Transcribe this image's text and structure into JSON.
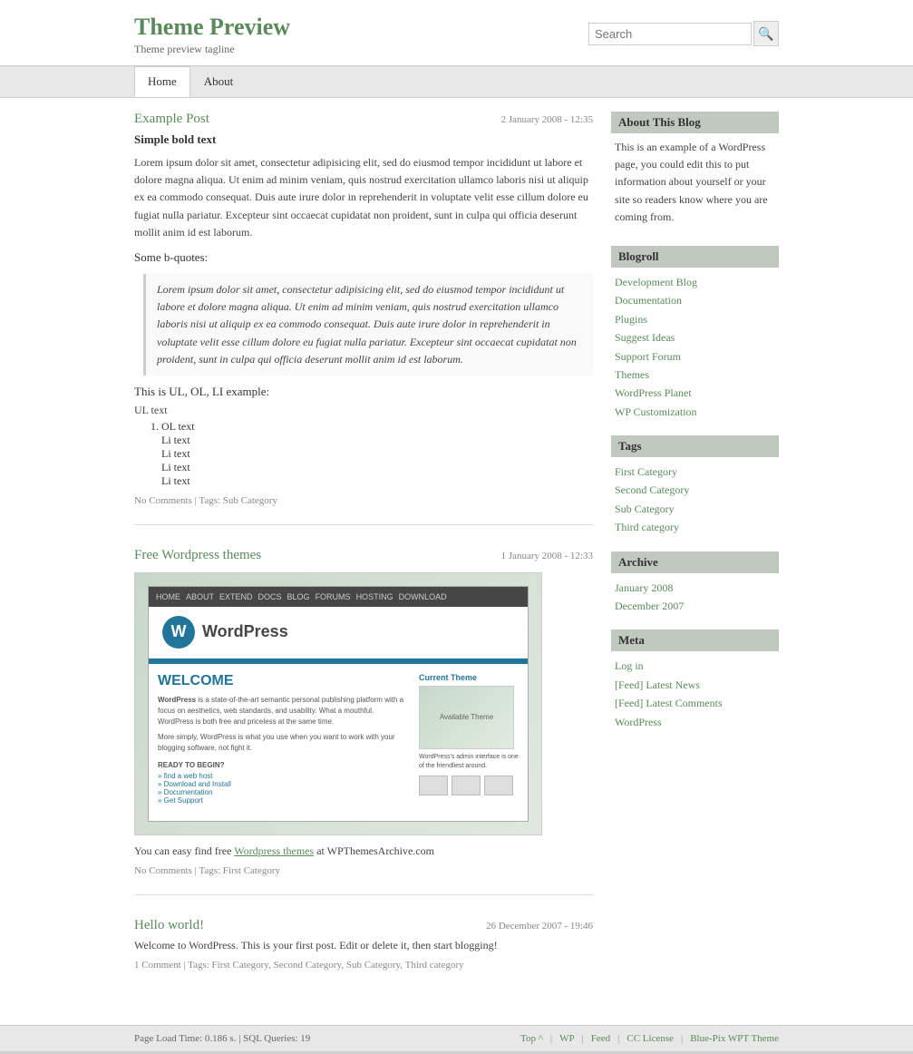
{
  "site": {
    "title": "Theme Preview",
    "tagline": "Theme preview tagline"
  },
  "search": {
    "placeholder": "Search",
    "button_label": "🔍"
  },
  "nav": {
    "items": [
      {
        "label": "Home",
        "active": true
      },
      {
        "label": "About",
        "active": false
      }
    ]
  },
  "posts": [
    {
      "title": "Example Post",
      "date": "2 January 2008 - 12:35",
      "bold": "Simple bold text",
      "content": "Lorem ipsum dolor sit amet, consectetur adipisicing elit, sed do eiusmod tempor incididunt ut labore et dolore magna aliqua. Ut enim ad minim veniam, quis nostrud exercitation ullamco laboris nisi ut aliquip ex ea commodo consequat. Duis aute irure dolor in reprehenderit in voluptate velit esse cillum dolore eu fugiat nulla pariatur. Excepteur sint occaecat cupidatat non proident, sunt in culpa qui officia deserunt mollit anim id est laborum.",
      "bquotes_label": "Some b-quotes:",
      "blockquote": "Lorem ipsum dolor sit amet, consectetur adipisicing elit, sed do eiusmod tempor incididunt ut labore et dolore magna aliqua. Ut enim ad minim veniam, quis nostrud exercitation ullamco laboris nisi ut aliquip ex ea commodo consequat. Duis aute irure dolor in reprehenderit in voluptate velit esse cillum dolore eu fugiat nulla pariatur. Excepteur sint occaecat cupidatat non proident, sunt in culpa qui officia deserunt mollit anim id est laborum.",
      "ul_ol_heading": "This is UL, OL, LI example:",
      "ul_label": "UL text",
      "ol_label": "OL text",
      "li_items": [
        "Li text",
        "Li text",
        "Li text",
        "Li text"
      ],
      "footer": "No Comments | Tags: Sub Category"
    },
    {
      "title": "Free Wordpress themes",
      "date": "1 January 2008 - 12:33",
      "text": "You can easy find free Wordpress themes at WPThemesArchive.com",
      "link_text": "Wordpress themes",
      "footer": "No Comments | Tags: First Category"
    },
    {
      "title": "Hello world!",
      "date": "26 December 2007 - 19:46",
      "text": "Welcome to WordPress. This is your first post. Edit or delete it, then start blogging!",
      "footer": "1 Comment | Tags: First Category, Second Category, Sub Category, Third category"
    }
  ],
  "sidebar": {
    "about_title": "About This Blog",
    "about_text": "This is an example of a WordPress page, you could edit this to put information about yourself or your site so readers know where you are coming from.",
    "blogroll_title": "Blogroll",
    "blogroll_items": [
      "Development Blog",
      "Documentation",
      "Plugins",
      "Suggest Ideas",
      "Support Forum",
      "Themes",
      "WordPress Planet",
      "WP Customization"
    ],
    "tags_title": "Tags",
    "tags_items": [
      "First Category",
      "Second Category",
      "Sub Category",
      "Third category"
    ],
    "archive_title": "Archive",
    "archive_items": [
      "January 2008",
      "December 2007"
    ],
    "meta_title": "Meta",
    "meta_items": [
      "Log in",
      "[Feed] Latest News",
      "[Feed] Latest Comments",
      "WordPress"
    ]
  },
  "footer": {
    "load_time": "Page Load Time: 0.186 s. | SQL Queries: 19",
    "top": "Top",
    "top_arrow": "^",
    "wp": "WP",
    "feed": "Feed",
    "cc_license": "CC License",
    "theme": "Blue-Pix WPT Theme"
  }
}
